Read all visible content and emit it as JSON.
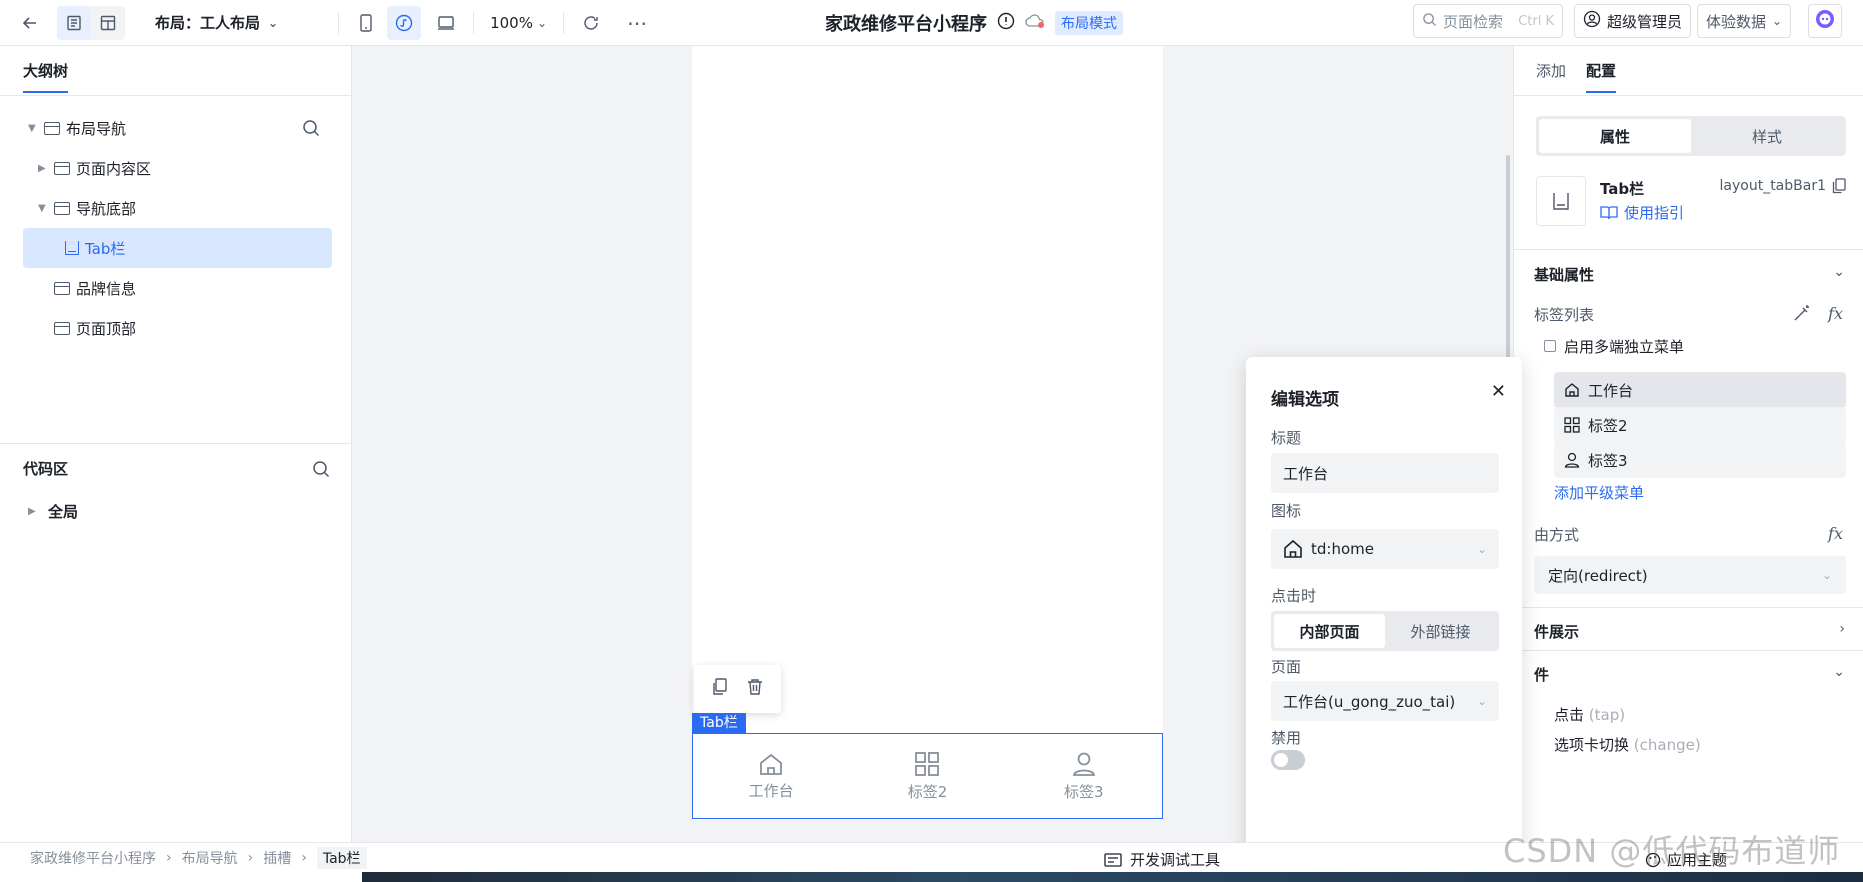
{
  "topbar": {
    "layout_label": "布局：工人布局",
    "zoom": "100%",
    "app_title": "家政维修平台小程序",
    "mode_badge": "布局模式",
    "search_placeholder": "页面检索",
    "search_shortcut": "Ctrl K",
    "admin_label": "超级管理员",
    "data_label": "体验数据"
  },
  "left": {
    "tab": "大纲树",
    "tree": [
      "布局导航",
      "页面内容区",
      "导航底部",
      "Tab栏",
      "品牌信息",
      "页面顶部"
    ],
    "code_title": "代码区",
    "code_global": "全局"
  },
  "canvas": {
    "selection_tag": "Tab栏",
    "tabbar": [
      "工作台",
      "标签2",
      "标签3"
    ]
  },
  "status": {
    "breadcrumb": [
      "家政维修平台小程序",
      "布局导航",
      "插槽",
      "Tab栏"
    ],
    "devtools": "开发调试工具",
    "theme": "应用主题",
    "watermark": "CSDN @低代码布道师"
  },
  "right": {
    "tabs": [
      "添加",
      "配置"
    ],
    "seg": [
      "属性",
      "样式"
    ],
    "comp_name": "Tab栏",
    "comp_guide": "使用指引",
    "comp_id": "layout_tabBar1",
    "basic_title": "基础属性",
    "tab_list_label": "标签列表",
    "multi_menu": "启用多端独立菜单",
    "options": [
      "工作台",
      "标签2",
      "标签3"
    ],
    "add_menu": "添加平级菜单",
    "jump_label": "由方式",
    "jump_value": "定向(redirect)",
    "display_title": "件展示",
    "event_title": "件",
    "event1": "点击",
    "event1_code": "(tap)",
    "event2": "选项卡切换",
    "event2_code": "(change)"
  },
  "popup": {
    "title": "编辑选项",
    "title_label": "标题",
    "title_value": "工作台",
    "icon_label": "图标",
    "icon_value": "td:home",
    "click_label": "点击时",
    "click_opts": [
      "内部页面",
      "外部链接"
    ],
    "page_label": "页面",
    "page_value": "工作台(u_gong_zuo_tai)",
    "disabled_label": "禁用"
  },
  "colors": {
    "accent": "#2b6bf3",
    "selected_bg": "#d8e6ff"
  }
}
